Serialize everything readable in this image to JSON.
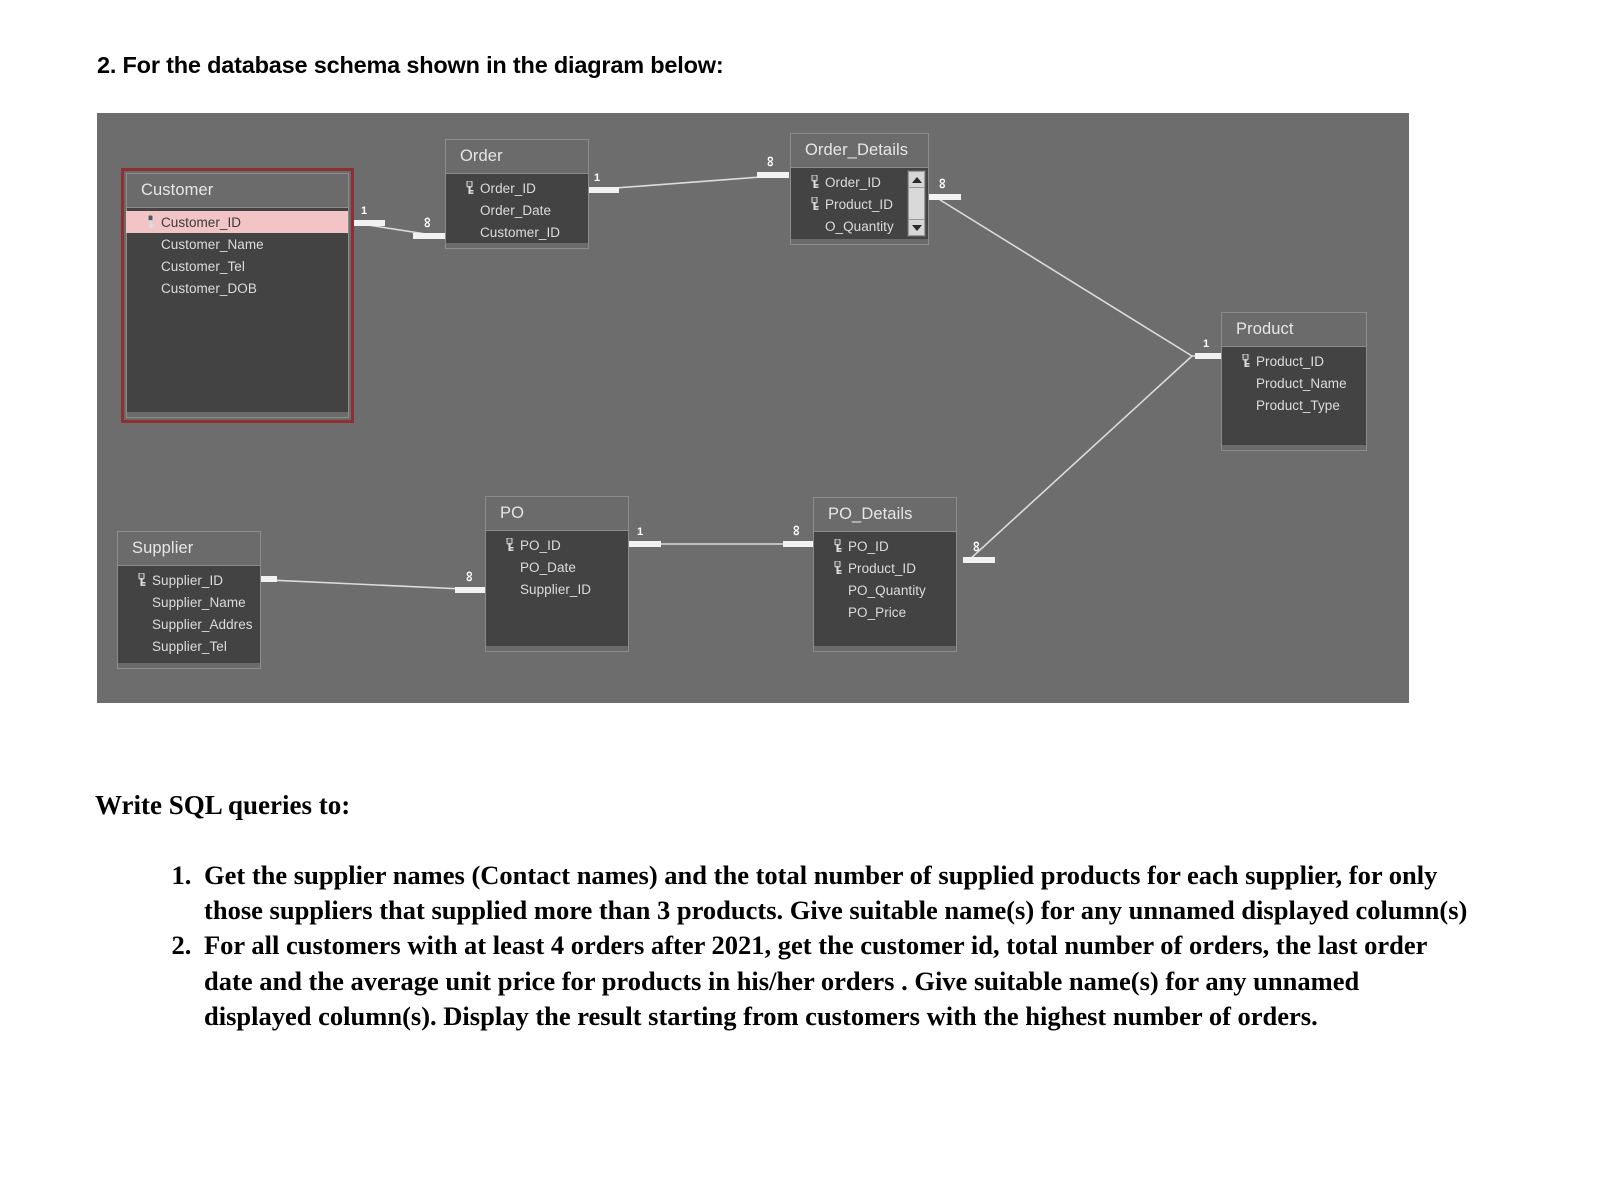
{
  "heading": "2. For the database schema shown in the diagram below:",
  "diagram": {
    "entities": [
      {
        "id": "customer",
        "title": "Customer",
        "selected": true,
        "fields": [
          {
            "label": "Customer_ID",
            "key": true,
            "highlight": true
          },
          {
            "label": "Customer_Name",
            "key": false,
            "highlight": false
          },
          {
            "label": "Customer_Tel",
            "key": false,
            "highlight": false
          },
          {
            "label": "Customer_DOB",
            "key": false,
            "highlight": false
          }
        ]
      },
      {
        "id": "order",
        "title": "Order",
        "selected": false,
        "fields": [
          {
            "label": "Order_ID",
            "key": true,
            "highlight": false
          },
          {
            "label": "Order_Date",
            "key": false,
            "highlight": false
          },
          {
            "label": "Customer_ID",
            "key": false,
            "highlight": false
          }
        ]
      },
      {
        "id": "order_details",
        "title": "Order_Details",
        "selected": false,
        "scrollbar": true,
        "fields": [
          {
            "label": "Order_ID",
            "key": true,
            "highlight": false
          },
          {
            "label": "Product_ID",
            "key": true,
            "highlight": false
          },
          {
            "label": "O_Quantity",
            "key": false,
            "highlight": false
          }
        ]
      },
      {
        "id": "product",
        "title": "Product",
        "selected": false,
        "fields": [
          {
            "label": "Product_ID",
            "key": true,
            "highlight": false
          },
          {
            "label": "Product_Name",
            "key": false,
            "highlight": false
          },
          {
            "label": "Product_Type",
            "key": false,
            "highlight": false
          }
        ]
      },
      {
        "id": "supplier",
        "title": "Supplier",
        "selected": false,
        "fields": [
          {
            "label": "Supplier_ID",
            "key": true,
            "highlight": false
          },
          {
            "label": "Supplier_Name",
            "key": false,
            "highlight": false
          },
          {
            "label": "Supplier_Addres",
            "key": false,
            "highlight": false
          },
          {
            "label": "Supplier_Tel",
            "key": false,
            "highlight": false
          }
        ]
      },
      {
        "id": "po",
        "title": "PO",
        "selected": false,
        "fields": [
          {
            "label": "PO_ID",
            "key": true,
            "highlight": false
          },
          {
            "label": "PO_Date",
            "key": false,
            "highlight": false
          },
          {
            "label": "Supplier_ID",
            "key": false,
            "highlight": false
          }
        ]
      },
      {
        "id": "po_details",
        "title": "PO_Details",
        "selected": false,
        "fields": [
          {
            "label": "PO_ID",
            "key": true,
            "highlight": false
          },
          {
            "label": "Product_ID",
            "key": true,
            "highlight": false
          },
          {
            "label": "PO_Quantity",
            "key": false,
            "highlight": false
          },
          {
            "label": "PO_Price",
            "key": false,
            "highlight": false
          }
        ]
      }
    ],
    "relationships": [
      {
        "id": "customer-order",
        "one": "1",
        "many": "∞"
      },
      {
        "id": "order-order_details",
        "one": "1",
        "many": "∞"
      },
      {
        "id": "order_details-product",
        "one": "1",
        "many": "∞"
      },
      {
        "id": "supplier-po",
        "one": "1",
        "many": "∞"
      },
      {
        "id": "po-po_details",
        "one": "1",
        "many": "∞"
      },
      {
        "id": "po_details-product",
        "one": "1",
        "many": "∞"
      }
    ],
    "colors": {
      "canvas": "#6d6d6d",
      "entity_header": "#6b6b6b",
      "entity_body": "#434343",
      "selection_border": "#8e2f33",
      "pk_highlight": "#f2c4c6",
      "connector": "#dcdcdc"
    }
  },
  "queries_heading": "Write SQL queries to:",
  "queries": [
    "Get the supplier names (Contact names) and the total number of supplied products for each supplier, for only those suppliers that supplied more than 3 products. Give suitable name(s) for any unnamed displayed column(s)",
    "For all customers with at least 4 orders after 2021, get the customer id, total number of orders, the last order date and the average unit price for products in his/her orders . Give suitable name(s) for any unnamed displayed column(s). Display the result starting from customers with the highest number of orders."
  ]
}
